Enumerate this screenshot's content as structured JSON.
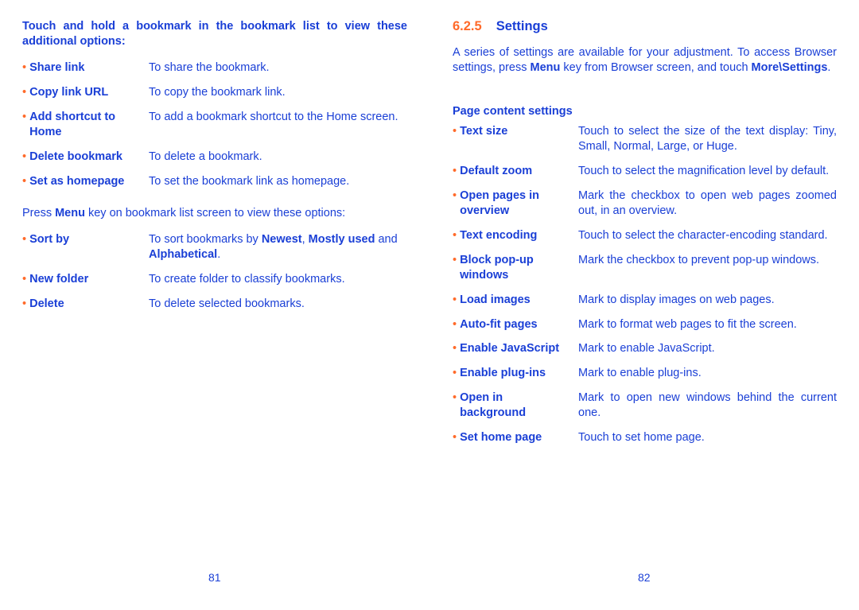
{
  "colors": {
    "text": "#1a3fd6",
    "bullet": "#ff6a2a"
  },
  "left": {
    "intro": "Touch and hold a bookmark in the bookmark list to view these additional options:",
    "items": [
      {
        "term": "Share link",
        "desc": "To share the bookmark."
      },
      {
        "term": "Copy link URL",
        "desc": "To copy the bookmark link."
      },
      {
        "term": "Add shortcut to Home",
        "desc": "To add a bookmark shortcut to the Home screen."
      },
      {
        "term": "Delete bookmark",
        "desc": "To delete a bookmark."
      },
      {
        "term": "Set as homepage",
        "desc": "To set the bookmark link as homepage."
      }
    ],
    "menu_para": {
      "pre": "Press ",
      "key": "Menu",
      "post": " key on bookmark list screen to view these options:"
    },
    "items2": [
      {
        "term": "Sort by",
        "desc_pre": "To sort bookmarks by ",
        "b1": "Newest",
        "sep": ", ",
        "b2": "Mostly used",
        "and": " and ",
        "b3": "Alphabetical",
        "end": "."
      },
      {
        "term": "New folder",
        "desc": "To create folder to classify bookmarks."
      },
      {
        "term": "Delete",
        "desc": "To delete selected bookmarks."
      }
    ],
    "page_number": "81"
  },
  "right": {
    "section_number": "6.2.5",
    "section_title": "Settings",
    "intro": {
      "pre": "A series of settings are available for your adjustment. To access Browser settings, press ",
      "key": "Menu",
      "mid": " key from Browser screen, and touch ",
      "path1": "More\\",
      "path2": "Settings",
      "end": "."
    },
    "subheading": "Page content settings",
    "items": [
      {
        "term": "Text size",
        "desc": "Touch to select the size of the text display: Tiny, Small, Normal, Large, or Huge."
      },
      {
        "term": "Default zoom",
        "desc": "Touch to select the magnification level by default."
      },
      {
        "term": "Open pages in overview",
        "desc": "Mark the checkbox to open web pages zoomed out, in an overview."
      },
      {
        "term": "Text encoding",
        "desc": "Touch to select the character-encoding standard."
      },
      {
        "term": "Block pop-up windows",
        "desc": "Mark the checkbox to prevent pop-up windows."
      },
      {
        "term": "Load images",
        "desc": "Mark to display images on web pages."
      },
      {
        "term": "Auto-fit pages",
        "desc": "Mark to format web pages to fit the screen."
      },
      {
        "term": "Enable JavaScript",
        "desc": "Mark to enable JavaScript."
      },
      {
        "term": "Enable plug-ins",
        "desc": "Mark to enable plug-ins."
      },
      {
        "term": "Open in background",
        "desc": "Mark to open new windows behind the current one."
      },
      {
        "term": "Set home page",
        "desc": "Touch to set home page."
      }
    ],
    "page_number": "82"
  }
}
